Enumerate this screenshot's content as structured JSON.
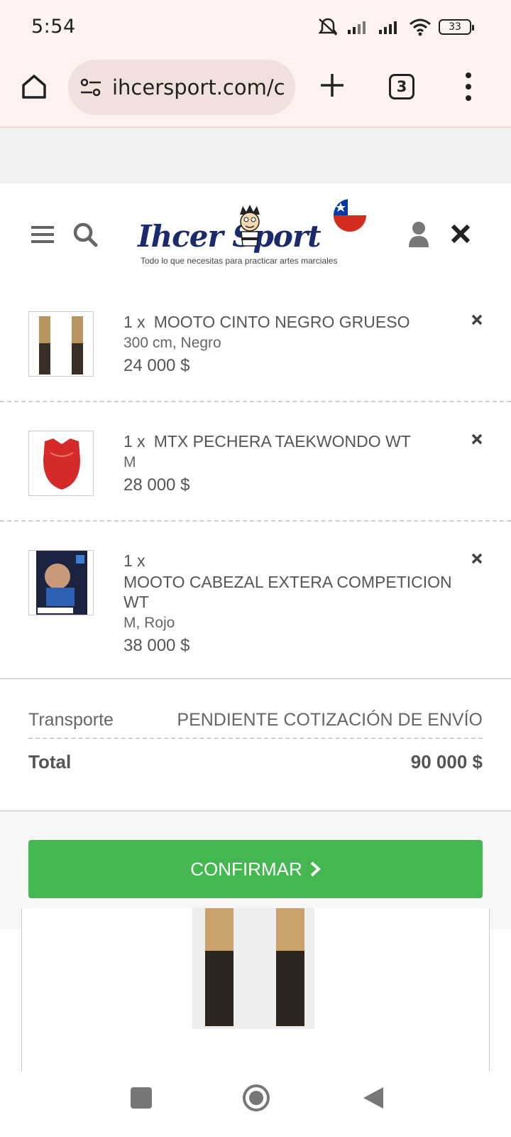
{
  "status_bar": {
    "time": "5:54",
    "battery": "33"
  },
  "browser": {
    "url": "ihcersport.com/c",
    "tab_count": "3"
  },
  "site": {
    "logo_text": "Ihcer Sport",
    "logo_tagline": "Todo lo que necesitas para practicar artes marciales"
  },
  "cart": {
    "items": [
      {
        "qty": "1 x",
        "name": "MOOTO CINTO NEGRO GRUESO",
        "variant": "300 cm, Negro",
        "price": "24 000 $"
      },
      {
        "qty": "1 x",
        "name": "MTX PECHERA TAEKWONDO WT",
        "variant": "M",
        "price": "28 000 $"
      },
      {
        "qty": "1 x",
        "name": "MOOTO CABEZAL EXTERA COMPETICION WT",
        "variant": "M, Rojo",
        "price": "38 000 $"
      }
    ],
    "shipping_label": "Transporte",
    "shipping_value": "PENDIENTE COTIZACIÓN DE ENVÍO",
    "total_label": "Total",
    "total_value": "90 000 $",
    "confirm_label": "CONFIRMAR"
  },
  "colors": {
    "accent_green": "#45b751",
    "logo_blue": "#1a2a6c",
    "browser_bg": "#fdf2ef"
  }
}
